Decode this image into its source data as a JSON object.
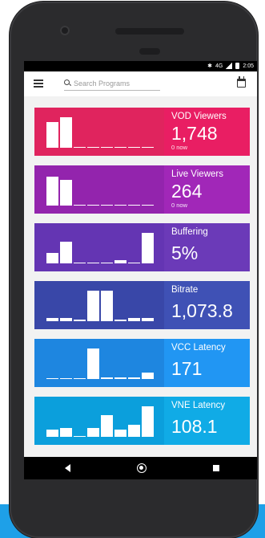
{
  "status_bar": {
    "time": "2:05",
    "network": "4G"
  },
  "app_bar": {
    "menu_icon": "hamburger-menu-icon",
    "search_placeholder": "Search Programs",
    "search_value": "",
    "calendar_icon": "calendar-icon"
  },
  "cards": [
    {
      "id": "vod-viewers",
      "label": "VOD Viewers",
      "value": "1,748",
      "sub": "0 now",
      "color_chart": "#e0245e",
      "color_info": "#e91e63",
      "bars": [
        0.85,
        1.0,
        0.03,
        0.03,
        0.03,
        0.03,
        0.03,
        0.03
      ]
    },
    {
      "id": "live-viewers",
      "label": "Live Viewers",
      "value": "264",
      "sub": "0 now",
      "color_chart": "#9324ad",
      "color_info": "#a127b8",
      "bars": [
        0.95,
        0.85,
        0.03,
        0.03,
        0.03,
        0.03,
        0.03,
        0.03
      ]
    },
    {
      "id": "buffering",
      "label": "Buffering",
      "value": "5%",
      "sub": "",
      "color_chart": "#6435b3",
      "color_info": "#6b3ab8",
      "bars": [
        0.35,
        0.7,
        0.03,
        0.03,
        0.03,
        0.1,
        0.03,
        1.0
      ]
    },
    {
      "id": "bitrate",
      "label": "Bitrate",
      "value": "1,073.8",
      "sub": "",
      "color_chart": "#3947a8",
      "color_info": "#3f51b5",
      "bars": [
        0.1,
        0.1,
        0.05,
        1.0,
        1.0,
        0.05,
        0.1,
        0.1
      ]
    },
    {
      "id": "vcc-latency",
      "label": "VCC Latency",
      "value": "171",
      "sub": "",
      "color_chart": "#1e86e0",
      "color_info": "#2196f3",
      "bars": [
        0.03,
        0.03,
        0.03,
        1.0,
        0.05,
        0.05,
        0.05,
        0.2
      ]
    },
    {
      "id": "vne-latency",
      "label": "VNE Latency",
      "value": "108.1",
      "sub": "",
      "color_chart": "#0b9fdc",
      "color_info": "#10abe6",
      "bars": [
        0.25,
        0.3,
        0.03,
        0.3,
        0.7,
        0.25,
        0.4,
        1.0
      ]
    }
  ],
  "nav_bar": {
    "back_icon": "back-triangle-icon",
    "home_icon": "home-circle-icon",
    "recents_icon": "recents-square-icon"
  }
}
